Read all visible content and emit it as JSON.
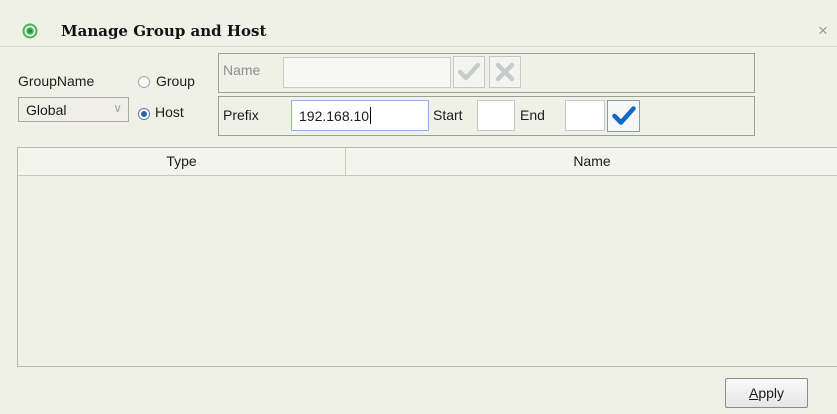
{
  "window": {
    "title": "Manage Group and Host",
    "close_glyph": "×"
  },
  "left": {
    "group_name_label": "GroupName",
    "group_name_value": "Global",
    "radio_group_label": "Group",
    "radio_host_label": "Host",
    "selected_radio": "Host"
  },
  "group_box": {
    "name_label": "Name",
    "name_value": ""
  },
  "host_box": {
    "prefix_label": "Prefix",
    "prefix_value": "192.168.10",
    "start_label": "Start",
    "start_value": "",
    "end_label": "End",
    "end_value": ""
  },
  "table": {
    "columns": [
      "Type",
      "Name"
    ],
    "rows": []
  },
  "footer": {
    "apply_label": "Apply"
  },
  "icons": {
    "app": "gear-ring-icon",
    "confirm_disabled": "check-icon",
    "cancel_disabled": "x-icon",
    "confirm": "check-icon"
  },
  "colors": {
    "check_active": "#0f67c8",
    "check_disabled": "#c9cccd",
    "background": "#f0f1e6"
  }
}
